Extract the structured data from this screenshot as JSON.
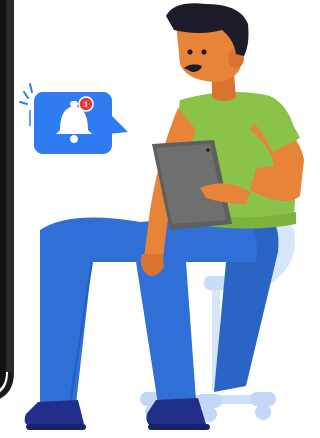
{
  "illustration": {
    "notification": {
      "icon": "bell-icon",
      "badge_count": "1"
    },
    "colors": {
      "phone_frame": "#111111",
      "notification_bubble": "#2f7bf0",
      "badge": "#e53935",
      "shirt": "#8bc34a",
      "pants": "#2f6fd6",
      "skin": "#e8833a",
      "hair": "#1c1c2a",
      "tablet": "#5f5f5f",
      "chair": "#d7e6fb",
      "shoes": "#1f2f8a"
    }
  }
}
